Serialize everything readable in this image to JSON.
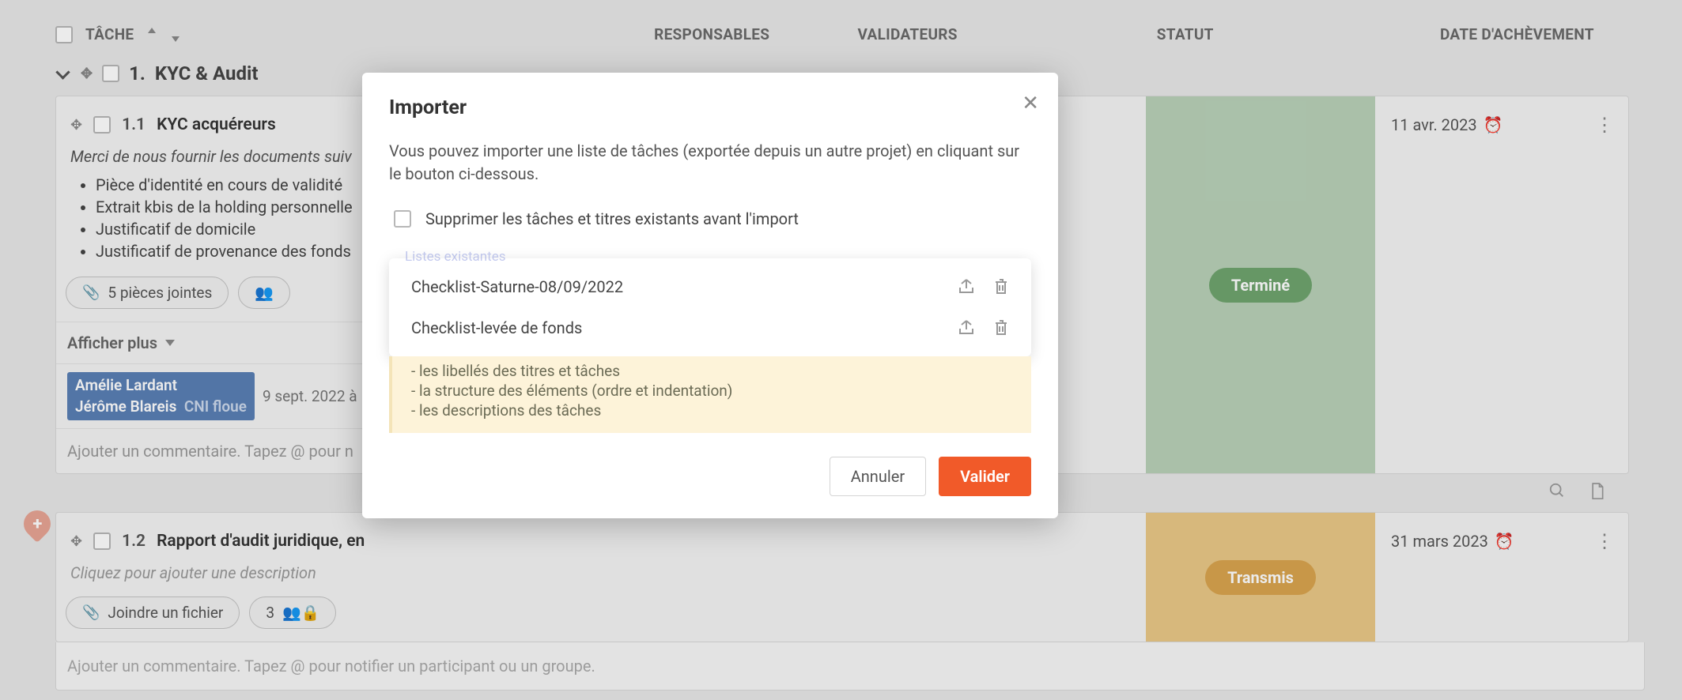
{
  "header": {
    "task": "TÂCHE",
    "resp": "RESPONSABLES",
    "valid": "VALIDATEURS",
    "status": "STATUT",
    "date": "DATE D'ACHÈVEMENT"
  },
  "section": {
    "num": "1.",
    "name": "KYC & Audit"
  },
  "tasks": [
    {
      "num": "1.1",
      "name": "KYC acquéreurs",
      "desc_intro": "Merci de nous fournir les documents suiv",
      "bullets": [
        "Pièce d'identité en cours de validité",
        "Extrait kbis de la holding personnelle",
        "Justificatif de domicile",
        "Justificatif de provenance des fonds"
      ],
      "attachments_label": "5 pièces jointes",
      "afficher_plus": "Afficher plus",
      "tag_name1": "Amélie Lardant",
      "tag_name2": "Jérôme Blareis",
      "tag_note": "CNI floue",
      "timestamp": "9 sept. 2022 à",
      "comment_placeholder": "Ajouter un commentaire. Tapez @ pour n",
      "status": "Terminé",
      "date": "11 avr. 2023"
    },
    {
      "num": "1.2",
      "name": "Rapport d'audit juridique, en",
      "desc_placeholder": "Cliquez pour ajouter une description",
      "attach_label": "Joindre un fichier",
      "count": "3",
      "comment_placeholder": "Ajouter un commentaire. Tapez @ pour notifier un participant ou un groupe.",
      "status": "Transmis",
      "date": "31 mars 2023"
    }
  ],
  "modal": {
    "title": "Importer",
    "desc": "Vous pouvez importer une liste de tâches (exportée depuis un autre projet) en cliquant sur le bouton ci-dessous.",
    "delete_existing": "Supprimer les tâches et titres existants avant l'import",
    "lists_label": "Listes existantes",
    "items": [
      "Checklist-Saturne-08/09/2022",
      "Checklist-levée de fonds"
    ],
    "info_lines": [
      "- les libellés des titres et tâches",
      "- la structure des éléments (ordre et indentation)",
      "- les descriptions des tâches"
    ],
    "cancel": "Annuler",
    "validate": "Valider"
  }
}
